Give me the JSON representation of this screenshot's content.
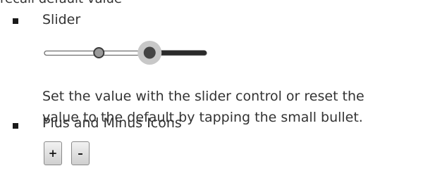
{
  "top_fragment": "recall default value",
  "items": [
    {
      "title": "Slider",
      "description_lines": [
        "Set the value with the slider control or reset the",
        "value to the default by tapping the small bullet."
      ]
    },
    {
      "title": "Plus and Minus Icons",
      "plus_symbol": "+",
      "minus_symbol": "–"
    }
  ],
  "slider": {
    "value": 0.65,
    "default_value": 0.33,
    "colors": {
      "track_empty_border": "#6f6f6f",
      "track_filled": "#2b2b2b",
      "knob_halo": "#c8c8c8",
      "knob": "#444444",
      "default_marker_fill": "#9a9a9a"
    }
  }
}
